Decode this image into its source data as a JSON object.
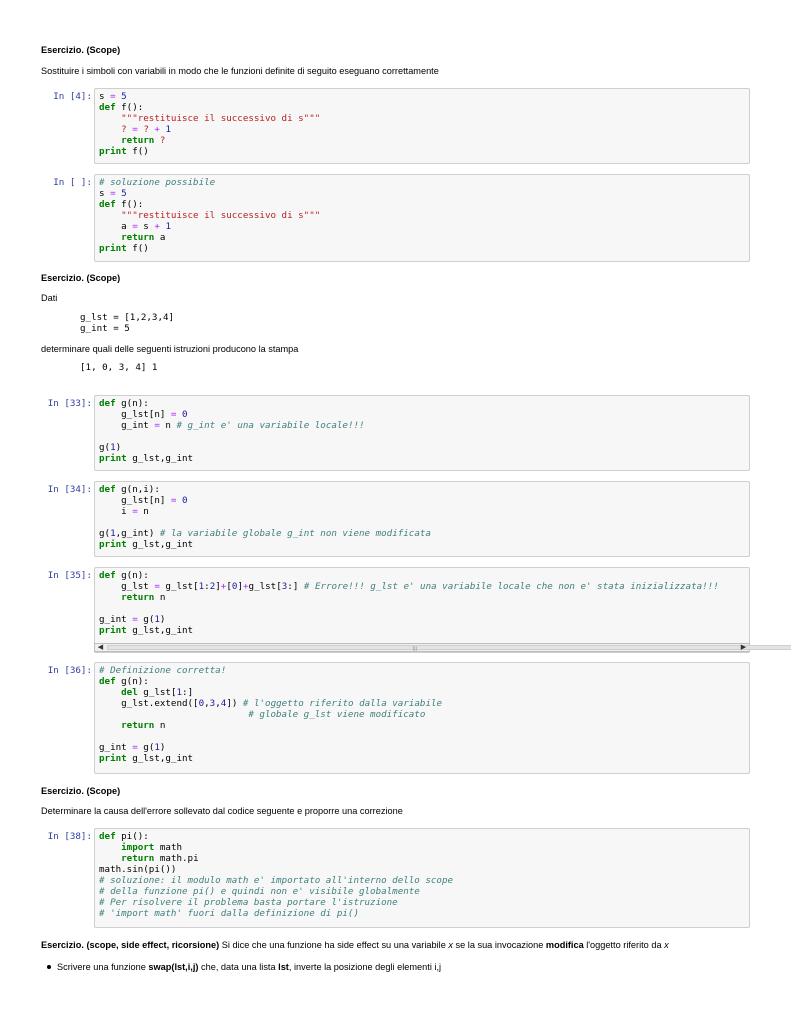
{
  "ex1": {
    "title": "Esercizio. (Scope)",
    "text": "Sostituire i simboli con variabili in modo che le funzioni definite di seguito eseguano correttamente"
  },
  "cells": {
    "c4": {
      "prompt": "In [4]:"
    },
    "cblank": {
      "prompt": "In [ ]:"
    },
    "c33": {
      "prompt": "In [33]:"
    },
    "c34": {
      "prompt": "In [34]:"
    },
    "c35": {
      "prompt": "In [35]:"
    },
    "c36": {
      "prompt": "In [36]:"
    },
    "c38": {
      "prompt": "In [38]:"
    }
  },
  "ex2": {
    "title": "Esercizio. (Scope)",
    "given": "Dati",
    "given_code": "g_lst = [1,2,3,4]\ng_int = 5",
    "question": "determinare quali delle seguenti istruzioni producono la stampa",
    "output_code": "[1, 0, 3, 4] 1"
  },
  "ex3": {
    "title": "Esercizio. (Scope)",
    "text": "Determinare la causa dell'errore sollevato dal codice seguente e proporre una correzione"
  },
  "ex4": {
    "title": "Esercizio. (scope, side effect, ricorsione)",
    "text_a": " Si dice che una funzione ha side effect su una variabile ",
    "var_x": "x",
    "text_b": " se la sua invocazione ",
    "modifica": "modifica",
    "text_c": " l'oggetto riferito da ",
    "var_x2": "x",
    "bullet_a": "Scrivere una funzione ",
    "bullet_fn": "swap(lst,i,j)",
    "bullet_b": " che, data una lista ",
    "bullet_lst": "lst",
    "bullet_c": ", inverte la posizione degli elementi i,j"
  },
  "icons": [
    "scroll-left-arrow-icon",
    "scroll-right-arrow-icon",
    "bullet-icon"
  ]
}
